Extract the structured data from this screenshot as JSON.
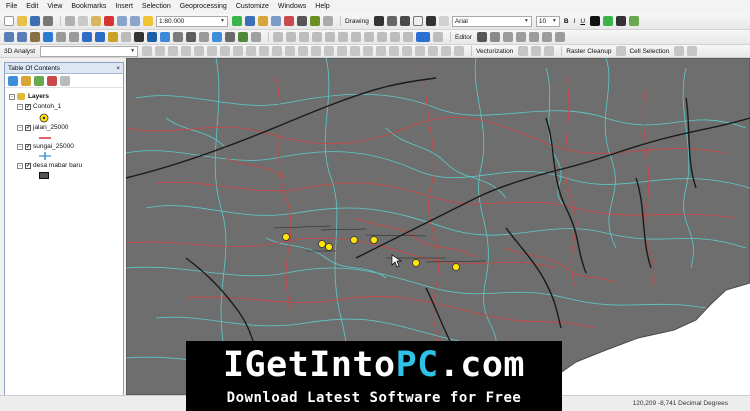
{
  "menu": [
    "File",
    "Edit",
    "View",
    "Bookmarks",
    "Insert",
    "Selection",
    "Geoprocessing",
    "Customize",
    "Windows",
    "Help"
  ],
  "toolbar": {
    "scale": "1:80.000",
    "drawing_label": "Drawing",
    "font_name": "Arial",
    "font_size": "10",
    "bold": "B",
    "italic": "I",
    "underline": "U",
    "editor_label": "Editor",
    "analyst_label": "3D Analyst",
    "vectorization_label": "Vectorization",
    "raster_cleanup_label": "Raster Cleanup",
    "cell_selection_label": "Cell Selection"
  },
  "toc": {
    "title": "Table Of Contents",
    "close": "×",
    "root": "Layers",
    "layers": [
      {
        "name": "Contoh_1",
        "symbol": "point",
        "color": "#ffe600"
      },
      {
        "name": "jalan_25000",
        "symbol": "line",
        "color": "#e03131"
      },
      {
        "name": "sungai_25000",
        "symbol": "line",
        "color": "#3c8fd8"
      },
      {
        "name": "desa mabar baru",
        "symbol": "polygon",
        "color": "#555555"
      }
    ]
  },
  "map": {
    "background": "#6e6e6e",
    "river_color": "#5ad6d6",
    "road_color": "#d64040",
    "point_color": "#ffe600"
  },
  "status": {
    "coords": "120,209  -8,741 Decimal Degrees"
  },
  "banner": {
    "title_part1": "IGetInto",
    "title_part2": "PC",
    "title_part3": ".com",
    "subtitle": "Download Latest Software for Free"
  }
}
